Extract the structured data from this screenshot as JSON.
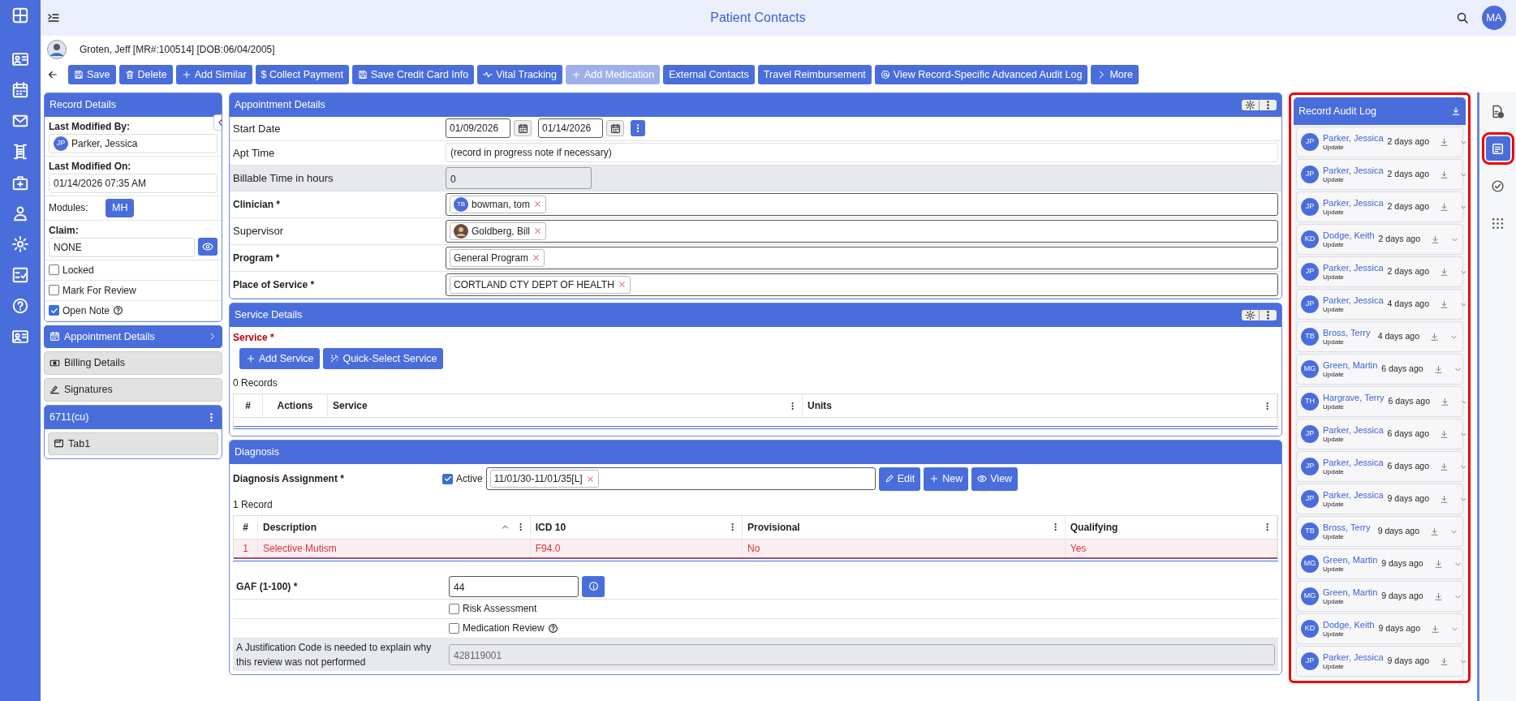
{
  "header": {
    "title": "Patient Contacts",
    "avatar": "MA"
  },
  "patient": {
    "text": "Groten, Jeff [MR#:100514] [DOB:06/04/2005]"
  },
  "toolbar": [
    {
      "label": "Save",
      "disabled": false
    },
    {
      "label": "Delete",
      "disabled": false
    },
    {
      "label": "Add Similar",
      "disabled": false
    },
    {
      "label": "$ Collect Payment",
      "disabled": false
    },
    {
      "label": "Save Credit Card Info",
      "disabled": false
    },
    {
      "label": "Vital Tracking",
      "disabled": false
    },
    {
      "label": "Add Medication",
      "disabled": true
    },
    {
      "label": "External Contacts",
      "disabled": false
    },
    {
      "label": "Travel Reimbursement",
      "disabled": false
    },
    {
      "label": "View Record-Specific Advanced Audit Log",
      "disabled": false
    },
    {
      "label": "More",
      "disabled": false
    }
  ],
  "record_details": {
    "title": "Record Details",
    "modified_by_label": "Last Modified By:",
    "modified_by": {
      "initials": "JP",
      "name": "Parker, Jessica"
    },
    "modified_on_label": "Last Modified On:",
    "modified_on": "01/14/2026 07:35 AM",
    "modules_label": "Modules:",
    "modules": [
      "MH"
    ],
    "claim_label": "Claim:",
    "claim": "NONE",
    "checks": [
      {
        "label": "Locked",
        "checked": false,
        "help": false
      },
      {
        "label": "Mark For Review",
        "checked": false,
        "help": false
      },
      {
        "label": "Open Note",
        "checked": true,
        "help": true
      }
    ]
  },
  "section_nav": [
    {
      "label": "Appointment Details",
      "selected": true
    },
    {
      "label": "Billing Details",
      "selected": false
    },
    {
      "label": "Signatures",
      "selected": false
    }
  ],
  "tab_group": {
    "title": "6711(cu)",
    "tabs": [
      "Tab1"
    ]
  },
  "appointment": {
    "title": "Appointment Details",
    "rows": [
      {
        "kind": "dates",
        "label": "Start Date",
        "bold": false,
        "values": [
          "01/09/2026",
          "01/14/2026"
        ]
      },
      {
        "kind": "text",
        "label": "Apt Time",
        "bold": false,
        "value": "(record in progress note if necessary)"
      },
      {
        "kind": "readonly",
        "label": "Billable Time in hours",
        "bold": false,
        "value": "0"
      },
      {
        "kind": "tags",
        "label": "Clinician *",
        "bold": true,
        "tags": [
          {
            "initials": "TB",
            "text": "bowman, tom"
          }
        ]
      },
      {
        "kind": "tags",
        "label": "Supervisor",
        "bold": false,
        "tags": [
          {
            "photo": true,
            "text": "Goldberg, Bill"
          }
        ]
      },
      {
        "kind": "tags",
        "label": "Program *",
        "bold": true,
        "tags": [
          {
            "text": "General Program"
          }
        ]
      },
      {
        "kind": "tags",
        "label": "Place of Service *",
        "bold": true,
        "tags": [
          {
            "text": "CORTLAND CTY DEPT OF HEALTH"
          }
        ]
      }
    ]
  },
  "service": {
    "title": "Service Details",
    "label": "Service *",
    "buttons": [
      "Add Service",
      "Quick-Select Service"
    ],
    "count": "0 Records",
    "columns": [
      "#",
      "Actions",
      "Service",
      "Units"
    ]
  },
  "diagnosis": {
    "title": "Diagnosis",
    "assignment_label": "Diagnosis Assignment *",
    "active": {
      "label": "Active",
      "checked": true
    },
    "tag": "11/01/30-11/01/35[L]",
    "buttons": [
      "Edit",
      "New",
      "View"
    ],
    "count": "1 Record",
    "columns": [
      "#",
      "Description",
      "ICD 10",
      "Provisional",
      "Qualifying"
    ],
    "rows": [
      [
        "1",
        "Selective Mutism",
        "F94.0",
        "No",
        "Yes"
      ]
    ],
    "gaf_label": "GAF (1-100) *",
    "gaf": "44",
    "checks": [
      {
        "label": "Risk Assessment",
        "checked": false,
        "help": false
      },
      {
        "label": "Medication Review",
        "checked": false,
        "help": true
      }
    ],
    "justification_label": "A Justification Code is needed to explain why this review was not performed",
    "justification": "428119001"
  },
  "audit_log": {
    "title": "Record Audit Log",
    "highlighted": true,
    "entries": [
      {
        "initials": "JP",
        "name": "Parker, Jessica",
        "action": "Update",
        "time": "2 days ago"
      },
      {
        "initials": "JP",
        "name": "Parker, Jessica",
        "action": "Update",
        "time": "2 days ago"
      },
      {
        "initials": "JP",
        "name": "Parker, Jessica",
        "action": "Update",
        "time": "2 days ago"
      },
      {
        "initials": "KD",
        "name": "Dodge, Keith",
        "action": "Update",
        "time": "2 days ago"
      },
      {
        "initials": "JP",
        "name": "Parker, Jessica",
        "action": "Update",
        "time": "2 days ago"
      },
      {
        "initials": "JP",
        "name": "Parker, Jessica",
        "action": "Update",
        "time": "4 days ago"
      },
      {
        "initials": "TB",
        "name": "Bross, Terry",
        "action": "Update",
        "time": "4 days ago"
      },
      {
        "initials": "MG",
        "name": "Green, Martin",
        "action": "Update",
        "time": "6 days ago"
      },
      {
        "initials": "TH",
        "name": "Hargrave, Terry",
        "action": "Update",
        "time": "6 days ago"
      },
      {
        "initials": "JP",
        "name": "Parker, Jessica",
        "action": "Update",
        "time": "6 days ago"
      },
      {
        "initials": "JP",
        "name": "Parker, Jessica",
        "action": "Update",
        "time": "6 days ago"
      },
      {
        "initials": "JP",
        "name": "Parker, Jessica",
        "action": "Update",
        "time": "9 days ago"
      },
      {
        "initials": "TB",
        "name": "Bross, Terry",
        "action": "Update",
        "time": "9 days ago"
      },
      {
        "initials": "MG",
        "name": "Green, Martin",
        "action": "Update",
        "time": "9 days ago"
      },
      {
        "initials": "MG",
        "name": "Green, Martin",
        "action": "Update",
        "time": "9 days ago"
      },
      {
        "initials": "KD",
        "name": "Dodge, Keith",
        "action": "Update",
        "time": "9 days ago"
      },
      {
        "initials": "JP",
        "name": "Parker, Jessica",
        "action": "Update",
        "time": "9 days ago"
      }
    ]
  },
  "right_rail": [
    {
      "selected": false,
      "highlighted": false
    },
    {
      "selected": true,
      "highlighted": true
    },
    {
      "selected": false,
      "highlighted": false
    },
    {
      "selected": false,
      "highlighted": false
    }
  ]
}
